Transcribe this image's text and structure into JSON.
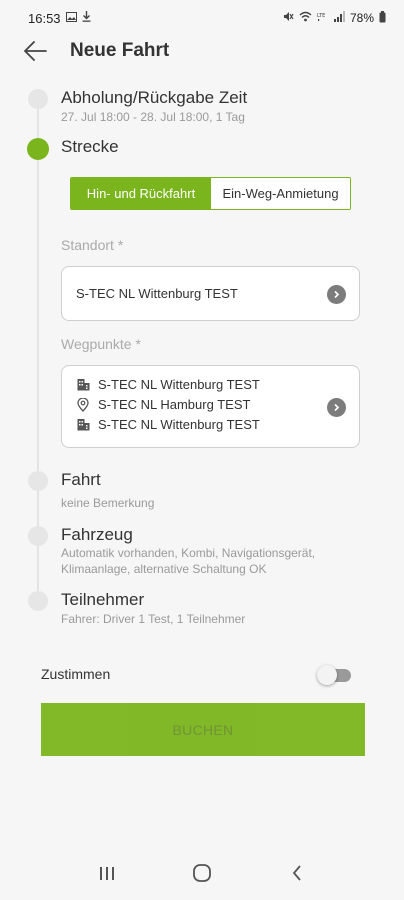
{
  "status_bar": {
    "time": "16:53",
    "battery": "78%",
    "icons": [
      "image-icon",
      "download-icon",
      "mute-icon",
      "wifi-icon",
      "lte-icon",
      "signal-icon",
      "battery-icon"
    ]
  },
  "header": {
    "title": "Neue Fahrt",
    "back_icon": "arrow-left-icon"
  },
  "steps": {
    "time": {
      "title": "Abholung/Rückgabe Zeit",
      "subtitle": "27. Jul 18:00 - 28. Jul 18:00, 1 Tag"
    },
    "route": {
      "title": "Strecke",
      "toggle": {
        "options": [
          "Hin- und Rückfahrt",
          "Ein-Weg-Anmietung"
        ],
        "selected": "Hin- und Rückfahrt"
      },
      "location_label": "Standort *",
      "location_value": "S-TEC NL Wittenburg TEST",
      "waypoints_label": "Wegpunkte *",
      "waypoints": [
        {
          "icon": "building-icon",
          "name": "S-TEC NL Wittenburg TEST"
        },
        {
          "icon": "location-pin-icon",
          "name": "S-TEC NL Hamburg TEST"
        },
        {
          "icon": "building-icon",
          "name": "S-TEC NL Wittenburg TEST"
        }
      ]
    },
    "trip": {
      "title": "Fahrt",
      "subtitle": "keine Bemerkung"
    },
    "vehicle": {
      "title": "Fahrzeug",
      "subtitle_line1": "Automatik vorhanden, Kombi, Navigationsgerät,",
      "subtitle_line2": "Klimaanlage, alternative Schaltung OK"
    },
    "participants": {
      "title": "Teilnehmer",
      "subtitle": "Fahrer: Driver 1 Test, 1 Teilnehmer"
    }
  },
  "agree": {
    "label": "Zustimmen",
    "checked": false
  },
  "book_button": {
    "label": "BUCHEN",
    "enabled": false
  },
  "colors": {
    "accent": "#7ab51d",
    "background": "#f6f6f6",
    "inactive_dot": "#e6e6e6"
  }
}
